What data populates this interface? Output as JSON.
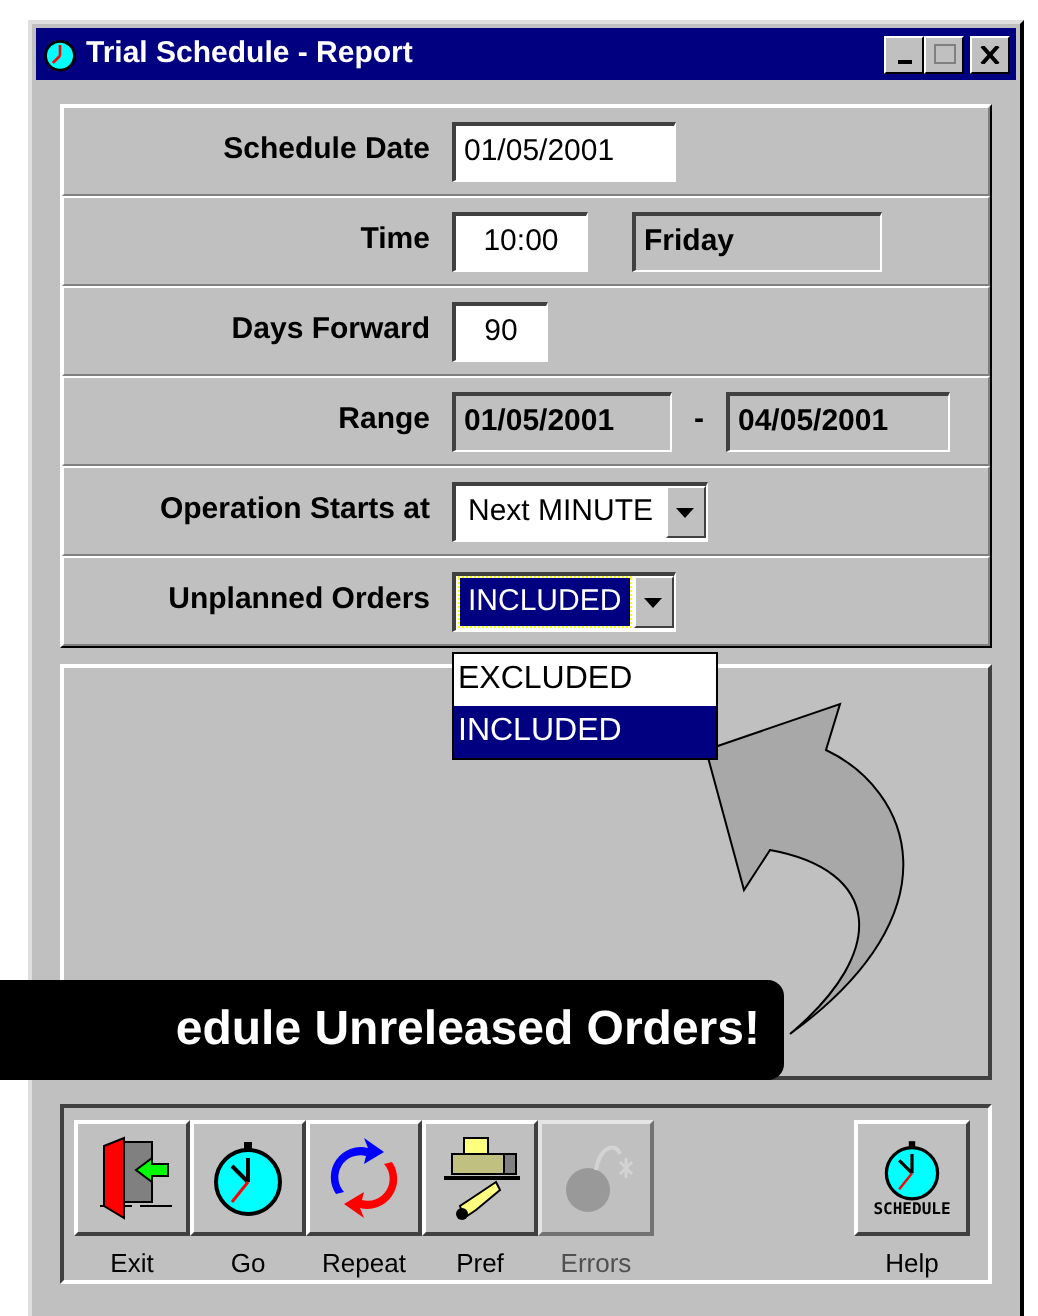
{
  "window": {
    "title": "Trial Schedule - Report"
  },
  "rows": [
    {
      "kind": "input",
      "label": "Schedule Date",
      "value": "01/05/2001"
    },
    {
      "kind": "input_display",
      "label": "Time",
      "value": "10:00",
      "display": "Friday"
    },
    {
      "kind": "input_center",
      "label": "Days Forward",
      "value": "90"
    },
    {
      "kind": "range",
      "label": "Range",
      "from": "01/05/2001",
      "separator": "-",
      "to": "04/05/2001"
    },
    {
      "kind": "combo",
      "label": "Operation Starts at",
      "value": "Next MINUTE",
      "focused": false
    },
    {
      "kind": "combo",
      "label": "Unplanned Orders",
      "value": "INCLUDED",
      "focused": true,
      "options": [
        {
          "label": "EXCLUDED",
          "selected": false
        },
        {
          "label": "INCLUDED",
          "selected": true
        }
      ]
    }
  ],
  "callout": {
    "text": "edule Unreleased Orders!"
  },
  "toolbar": {
    "left": [
      {
        "kind": "exit",
        "label": "Exit",
        "disabled": false
      },
      {
        "kind": "timer",
        "label": "Go",
        "disabled": false
      },
      {
        "kind": "repeat",
        "label": "Repeat",
        "disabled": false
      },
      {
        "kind": "pref",
        "label": "Pref",
        "disabled": false
      },
      {
        "kind": "errors",
        "label": "Errors",
        "disabled": true
      }
    ],
    "right": [
      {
        "kind": "schedule",
        "label": "Help",
        "icon_text": "SCHEDULE",
        "disabled": false
      }
    ]
  }
}
